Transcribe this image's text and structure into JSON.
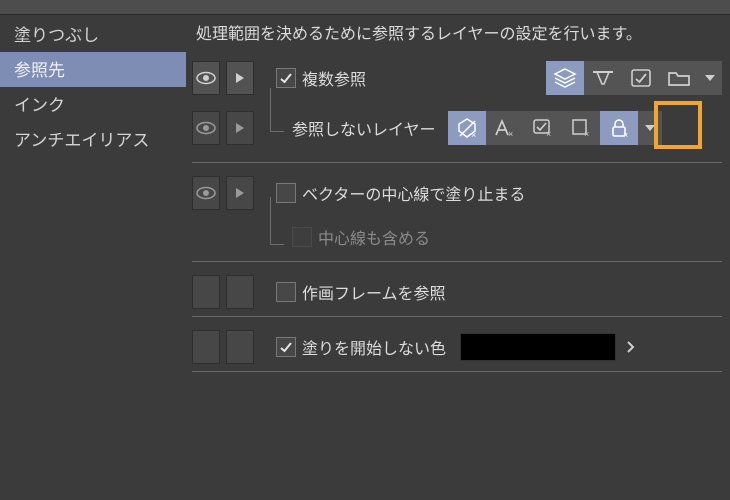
{
  "sidebar": {
    "items": [
      {
        "label": "塗りつぶし"
      },
      {
        "label": "参照先"
      },
      {
        "label": "インク"
      },
      {
        "label": "アンチエイリアス"
      }
    ],
    "activeIndex": 1
  },
  "description": "処理範囲を決めるために参照するレイヤーの設定を行います。",
  "rows": {
    "multi_ref": {
      "checked": true,
      "label": "複数参照"
    },
    "not_ref_layer": {
      "label": "参照しないレイヤー"
    },
    "vector_center": {
      "checked": false,
      "label": "ベクターの中心線で塗り止まる"
    },
    "include_center": {
      "checked": false,
      "label": "中心線も含める"
    },
    "frame_ref": {
      "checked": false,
      "label": "作画フレームを参照"
    },
    "no_start_color": {
      "checked": true,
      "label": "塗りを開始しない色",
      "color": "#000000"
    }
  }
}
